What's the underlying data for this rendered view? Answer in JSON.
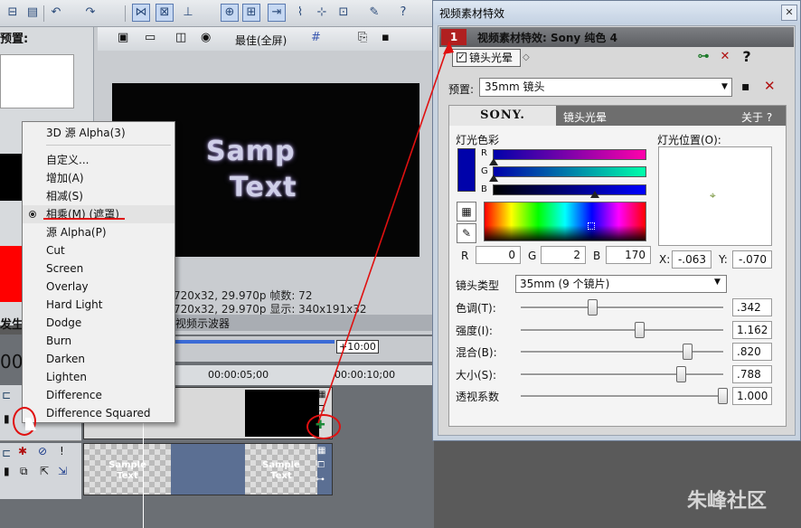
{
  "toolbar": {
    "time": "+10:00"
  },
  "left_panel": {
    "title": "预置:",
    "bottom_label": "发生器"
  },
  "preview": {
    "quality": "最佳(全屏)",
    "sample_line1": "Samp",
    "sample_line2": "Text",
    "info_line1": "720x32, 29.970p  帧数: 72",
    "info_line2": "720x32, 29.970p  显示: 340x191x32",
    "tab_label": "视频示波器"
  },
  "timeline": {
    "track_number": "00",
    "marker": "+10:00",
    "ruler_a": "00:00:05;00",
    "ruler_b": "00:00:10;00",
    "clip_text_1": "Sample",
    "clip_text_2": "Text"
  },
  "menu": {
    "items": [
      "3D 源 Alpha(3)",
      "自定义...",
      "增加(A)",
      "相减(S)",
      "相乘(M) (遮罩)",
      "源 Alpha(P)",
      "Cut",
      "Screen",
      "Overlay",
      "Hard Light",
      "Dodge",
      "Burn",
      "Darken",
      "Lighten",
      "Difference",
      "Difference Squared"
    ],
    "checked_index": 4
  },
  "dialog": {
    "title": "视频素材特效",
    "close": "✕",
    "chain_number": "1",
    "chain_title": "视频素材特效: Sony 纯色 4",
    "fx_tab": "镜头光晕",
    "preset_label": "预置:",
    "preset_value": "35mm 镜头",
    "plugin": {
      "brand": "SONY.",
      "name": "镜头光晕",
      "about": "关于  ?",
      "color_label": "灯光色彩",
      "position_label": "灯光位置(O):",
      "channels": [
        "R",
        "G",
        "B"
      ],
      "r_label": "R",
      "r_value": "0",
      "g_label": "G",
      "g_value": "2",
      "b_label": "B",
      "b_value": "170",
      "x_label": "X:",
      "x_value": "-.063",
      "y_label": "Y:",
      "y_value": "-.070",
      "lens_label": "镜头类型",
      "lens_value": "35mm (9 个镜片)",
      "sliders": [
        {
          "label": "色调(T):",
          "value": ".342",
          "level": 0.34
        },
        {
          "label": "强度(I):",
          "value": "1.162",
          "level": 0.58
        },
        {
          "label": "混合(B):",
          "value": ".820",
          "level": 0.82
        },
        {
          "label": "大小(S):",
          "value": ".788",
          "level": 0.79
        },
        {
          "label": "透视系数",
          "value": "1.000",
          "level": 1.0
        }
      ]
    }
  },
  "watermark": "朱峰社区"
}
